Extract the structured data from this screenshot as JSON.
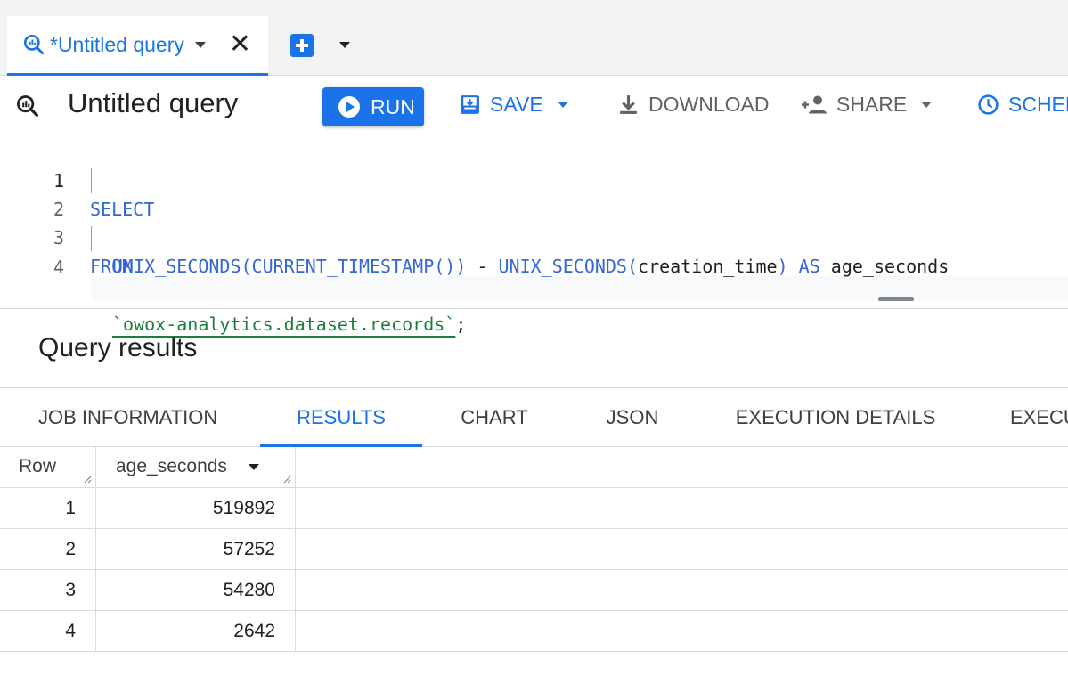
{
  "tab": {
    "label": "*Untitled query",
    "icon": "query-icon"
  },
  "toolbar": {
    "title": "Untitled query",
    "run": "RUN",
    "save": "SAVE",
    "download": "DOWNLOAD",
    "share": "SHARE",
    "schedule": "SCHED"
  },
  "editor": {
    "line_numbers": [
      "1",
      "2",
      "3",
      "4"
    ],
    "line1": {
      "kw": "SELECT"
    },
    "line2": {
      "f1": "UNIX_SECONDS(CURRENT_TIMESTAMP())",
      "op": " - ",
      "f2": "UNIX_SECONDS(",
      "arg": "creation_time",
      "close": ")",
      "as": " AS ",
      "alias": "age_seconds"
    },
    "line3": {
      "kw": "FROM"
    },
    "line4": {
      "table": "`owox-analytics.dataset.records`",
      "semi": ";"
    }
  },
  "results": {
    "title": "Query results",
    "tabs": [
      "JOB INFORMATION",
      "RESULTS",
      "CHART",
      "JSON",
      "EXECUTION DETAILS",
      "EXECU"
    ],
    "active_tab": "RESULTS",
    "columns": [
      "Row",
      "age_seconds"
    ],
    "rows": [
      {
        "row": "1",
        "age_seconds": "519892"
      },
      {
        "row": "2",
        "age_seconds": "57252"
      },
      {
        "row": "3",
        "age_seconds": "54280"
      },
      {
        "row": "4",
        "age_seconds": "2642"
      }
    ]
  },
  "colors": {
    "accent": "#1a73e8",
    "string": "#188038",
    "keyword": "#3367d6"
  }
}
